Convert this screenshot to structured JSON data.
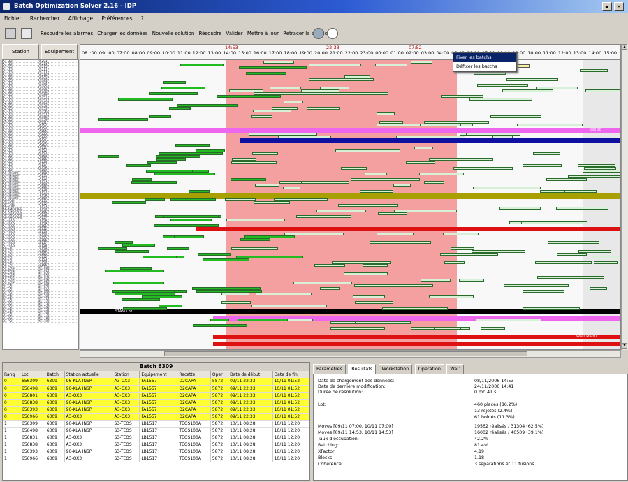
{
  "window": {
    "title": "Batch Optimization Solver 2.16 - IDP",
    "btn_min": "▪",
    "btn_close": "✕"
  },
  "menu": [
    "Fichier",
    "Rechercher",
    "Affichage",
    "Préférences",
    "?"
  ],
  "toolbar": {
    "actions": [
      "Résoudre les alarmes",
      "Charger les données",
      "Nouvelle solution",
      "Résoudre",
      "Valider",
      "Mettre à jour",
      "Retracer la solution"
    ]
  },
  "gantt_header": {
    "station_label": "Station",
    "equipment_label": "Equipement",
    "time_ticks": "08 :00 09 :00 07:00 08:00 09:00 10:00 11:00 12:00 13:00 14:00 15:00 16:00 17:00 18:00 19:00 20:00 21:00 22:00 23:00 00:00 01:00 02:00 03:00 04:00 05:00 06:00 07:00 08:00 09:00 10:00 11:00 12:00 13:00 14:00 15:00 16:00 17:00",
    "markers": [
      "14:53",
      "22:33",
      "07:52"
    ]
  },
  "row_labels": [
    [
      "A1-DOI",
      "RS201"
    ],
    [
      "A1-DOI",
      "RS2147"
    ],
    [
      "A1-DOI",
      "RS2157"
    ],
    [
      "A1-DOI",
      "RS2117"
    ],
    [
      "A1-DOI",
      "RS2177"
    ],
    [
      "A1-DOI",
      "RS2187"
    ],
    [
      "A1-DOI",
      "RS1817"
    ],
    [
      "A1-DOI",
      "RS1837"
    ],
    [
      "A1-DOI",
      "RS1847"
    ],
    [
      "A1-DOI",
      "RS1857"
    ],
    [
      "A1-DOI",
      "RS1867"
    ],
    [
      "A1-DOI",
      "RS1887"
    ],
    [
      "A1-DOI",
      "RS1897"
    ],
    [
      "A1-DOI",
      "RS1517"
    ],
    [
      "A2-DOI",
      "RS1527"
    ],
    [
      "A2-DOI",
      "RS1537"
    ],
    [
      "A2-DOI",
      "RS1547"
    ],
    [
      "A2-DOI",
      "RS1557"
    ],
    [
      "A2-DOI",
      "RS1567"
    ],
    [
      "A2-DOI",
      "RS1577"
    ],
    [
      "A2-DOI",
      "RS1587"
    ],
    [
      "A2-DOI",
      "RS1597"
    ],
    [
      "A3-DOI",
      "FA1517"
    ],
    [
      "A3-DOI",
      "FA1527"
    ],
    [
      "A3-DOI",
      "FA1537"
    ],
    [
      "A3-DOI",
      "FA1547"
    ],
    [
      "A3-DOI",
      "FA1557"
    ],
    [
      "A3-DOI",
      "FA1567"
    ],
    [
      "A3-DOI",
      "FA1577"
    ],
    [
      "A3-DOI",
      "FA1587"
    ],
    [
      "A3-DOI",
      "FA1597"
    ],
    [
      "A4-DOI",
      "PS1517"
    ],
    [
      "A4-DOI",
      "PS1527"
    ],
    [
      "A4-DOI",
      "PS1537"
    ],
    [
      "A4-DOI",
      "PS1547"
    ],
    [
      "A4-DOI",
      "PS1557"
    ],
    [
      "A4-DOI",
      "PS1567"
    ],
    [
      "A4-DOI",
      "PS1577"
    ],
    [
      "A4-DOI",
      "PS1587"
    ],
    [
      "A4-DOI",
      "PS1597"
    ],
    [
      "A5-THIN NF",
      "LA1507"
    ],
    [
      "A5-THIN NF",
      "LA1517"
    ],
    [
      "A5-THIN NF",
      "LA1527"
    ],
    [
      "A5-THIN NF",
      "LA1537"
    ],
    [
      "A5-THIN NF",
      "LA1547"
    ],
    [
      "A5-THIN NF",
      "LA1557"
    ],
    [
      "A5-THIN NF",
      "LA1567"
    ],
    [
      "A5-THIN NF",
      "LA1577"
    ],
    [
      "A5-THIN NF",
      "LA1587"
    ],
    [
      "A5-THIN NF",
      "LA1597"
    ],
    [
      "A6-POLY",
      "LA1517"
    ],
    [
      "A6-POLY",
      "LA1527"
    ],
    [
      "A6-POLY",
      "LA1537"
    ],
    [
      "A6-AMORPHE",
      "LA1547"
    ],
    [
      "A6-AMORPHE",
      "LA1557"
    ],
    [
      "A6-AMORPHE",
      "LA1567"
    ],
    [
      "A6-AMORPHE",
      "LA1577"
    ],
    [
      "A7-TEOS",
      "LA1587"
    ],
    [
      "A7-TEOS",
      "LA1597"
    ],
    [
      "A7-TEOS",
      "LB1517"
    ],
    [
      "A7-TEOS",
      "LB1527"
    ],
    [
      "A7-TEOS",
      "LB1537"
    ],
    [
      "A7-TEOS",
      "LB1547"
    ],
    [
      "A7-TEOS",
      "LB1557"
    ],
    [
      "A7-TEOS",
      "LB1567"
    ],
    [
      "A7-TEOS",
      "LB1577"
    ],
    [
      "A7-TEOS",
      "LB1587"
    ],
    [
      "A8-EPI",
      "LB1597"
    ],
    [
      "A8-EPI",
      "LC1507"
    ],
    [
      "A8-EPI",
      "LC1517"
    ],
    [
      "A8-EPI",
      "LC1527"
    ],
    [
      "A8-EPI",
      "LC1537"
    ],
    [
      "A8-EPI",
      "LC1547"
    ],
    [
      "A8-EPI",
      "LC1557"
    ],
    [
      "A9-SPIN",
      "MT1007"
    ],
    [
      "A9-SPIN",
      "MT1017"
    ],
    [
      "A9-SPIN",
      "MT1027"
    ],
    [
      "A9-SPIN",
      "MT1037"
    ],
    [
      "A9-SPIN",
      "MT1047"
    ],
    [
      "A9-SPIN",
      "MT1057"
    ],
    [
      "B1-PSI",
      "MT1067"
    ],
    [
      "B1-PSI",
      "MT1077"
    ],
    [
      "B1-PSI",
      "MT1087"
    ],
    [
      "B1-PSI",
      "MT1097"
    ],
    [
      "B1-PSI",
      "MT1107"
    ],
    [
      "B1-PSI",
      "MT1117"
    ],
    [
      "B1-PSI",
      "MT1127"
    ],
    [
      "B1-PSI",
      "MT1137"
    ],
    [
      "B1-PSI",
      "MT1147"
    ],
    [
      "B1-PSI",
      "MT1157"
    ],
    [
      "B1-PSI",
      "MT1167"
    ],
    [
      "B1-PSI",
      "MT1177"
    ],
    [
      "B1-PSI",
      "MT1187"
    ],
    [
      "B1-PSI",
      "MT1197"
    ]
  ],
  "context_menu": [
    "Fixer les batchs",
    "Défixer les batchs"
  ],
  "lane_labels": {
    "oxide": "OXIDE",
    "stand_by": "STAND BY",
    "wait_maint": "WAIT MAINT"
  },
  "batch_panel": {
    "title": "Batch 6309",
    "columns": [
      "Rang",
      "Lot",
      "Batch",
      "Station actuelle",
      "Station",
      "Equipement",
      "Recette",
      "Oper",
      "Date de début",
      "Date de fin"
    ],
    "rows": [
      {
        "hl": true,
        "cells": [
          "0",
          "656309",
          "6309",
          "96-KLA INSP",
          "A3-OX3",
          "FA1557",
          "D2CAPA",
          "5872",
          "09/11 22:33",
          "10/11 01:52"
        ]
      },
      {
        "hl": true,
        "cells": [
          "0",
          "656498",
          "6309",
          "96-KLA INSP",
          "A3-OX3",
          "FA1557",
          "D2CAPA",
          "5872",
          "09/11 22:33",
          "10/11 01:52"
        ]
      },
      {
        "hl": true,
        "cells": [
          "0",
          "656801",
          "6309",
          "A3-OX3",
          "A3-OX3",
          "FA1557",
          "D2CAPA",
          "5872",
          "09/11 22:33",
          "10/11 01:52"
        ]
      },
      {
        "hl": true,
        "cells": [
          "0",
          "656838",
          "6309",
          "96-KLA INSP",
          "A3-OX3",
          "FA1557",
          "D2CAPA",
          "5872",
          "09/11 22:33",
          "10/11 01:52"
        ]
      },
      {
        "hl": true,
        "cells": [
          "0",
          "656393",
          "6309",
          "96-KLA INSP",
          "A3-OX3",
          "FA1557",
          "D2CAPA",
          "5872",
          "09/11 22:33",
          "10/11 01:52"
        ]
      },
      {
        "hl": true,
        "cells": [
          "0",
          "656966",
          "6309",
          "A3-OX3",
          "A3-OX3",
          "FA1557",
          "D2CAPA",
          "5872",
          "09/11 22:33",
          "10/11 01:52"
        ]
      },
      {
        "hl": false,
        "cells": [
          "1",
          "656309",
          "6309",
          "96-KLA INSP",
          "S3-TEOS",
          "LB1517",
          "TEOS100A",
          "5872",
          "10/11 08:28",
          "10/11 12:20"
        ]
      },
      {
        "hl": false,
        "cells": [
          "1",
          "656498",
          "6309",
          "96-KLA INSP",
          "S3-TEOS",
          "LB1517",
          "TEOS100A",
          "5872",
          "10/11 08:28",
          "10/11 12:20"
        ]
      },
      {
        "hl": false,
        "cells": [
          "1",
          "656831",
          "6309",
          "A3-OX3",
          "S3-TEOS",
          "LB1517",
          "TEOS100A",
          "5872",
          "10/11 08:28",
          "10/11 12:20"
        ]
      },
      {
        "hl": false,
        "cells": [
          "1",
          "656838",
          "6309",
          "A3-OX3",
          "S3-TEOS",
          "LB1517",
          "TEOS100A",
          "5872",
          "10/11 08:28",
          "10/11 12:20"
        ]
      },
      {
        "hl": false,
        "cells": [
          "1",
          "656393",
          "6309",
          "96-KLA INSP",
          "S3-TEOS",
          "LB1517",
          "TEOS100A",
          "5872",
          "10/11 08:28",
          "10/11 12:20"
        ]
      },
      {
        "hl": false,
        "cells": [
          "1",
          "656966",
          "6309",
          "A3-OX3",
          "S3-TEOS",
          "LB1517",
          "TEOS100A",
          "5872",
          "10/11 08:28",
          "10/11 12:20"
        ]
      }
    ]
  },
  "info_panel": {
    "tabs": [
      "Paramètres",
      "Résultats",
      "Workstation",
      "Opération",
      "WaD"
    ],
    "active_tab": 1,
    "stats": [
      {
        "label": "Date de chargement des données:",
        "value": "08/11/2006 14:53"
      },
      {
        "label": "Date de dernière modification:",
        "value": "24/11/2006 14:41"
      },
      {
        "label": "Durée de résolution:",
        "value": "0 mn 41 s"
      },
      {
        "label": "Lot:",
        "value": "460 placés (86.2%)"
      },
      {
        "label": "",
        "value": "13 rejetés (2.4%)"
      },
      {
        "label": "",
        "value": "61 holdés (11.3%)"
      },
      {
        "label": "Moves [09/11 07:00, 10/11 07:00]",
        "value": "19562 réalisés / 31304 (62.5%)"
      },
      {
        "label": "Moves [09/11 14:53, 10/11 14:53]",
        "value": "16002 réalisés / 40509 (39.1%)"
      },
      {
        "label": "Taux d'occupation:",
        "value": "42.2%"
      },
      {
        "label": "Batching:",
        "value": "81.4%"
      },
      {
        "label": "XFactor:",
        "value": "4.19"
      },
      {
        "label": "Blocks:",
        "value": "1.18"
      },
      {
        "label": "Cohérence:",
        "value": "3 séparations et 11 fusions"
      }
    ]
  },
  "colors": {
    "accent": "#0a246a",
    "gantt_window": "#f4a0a0",
    "bar_green_dark": "#22bb22",
    "bar_green_light": "#d8f0d8",
    "lane_magenta": "#ee66ee",
    "lane_blue": "#1010a0",
    "lane_red": "#dd1111",
    "lane_olive": "#a8a000",
    "highlight_yellow": "#ffff33"
  }
}
